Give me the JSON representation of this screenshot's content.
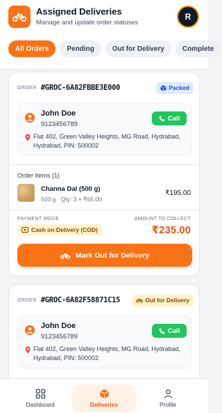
{
  "header": {
    "title": "Assigned Deliveries",
    "subtitle": "Manage and update order statuses",
    "avatar_initial": "R",
    "accent_color": "#f97316"
  },
  "tabs": [
    {
      "label": "All Orders",
      "active": true
    },
    {
      "label": "Pending",
      "active": false
    },
    {
      "label": "Out for Delivery",
      "active": false
    },
    {
      "label": "Complete",
      "active": false
    }
  ],
  "orders": [
    {
      "order_label": "ORDER",
      "order_id": "#GROC-6A82FBBE3E000",
      "status": "Packed",
      "customer": {
        "name": "John Doe",
        "phone": "9123456789",
        "call_label": "Call",
        "address": "Flat 402, Green Valley Heights, MG Road, Hydrabad, Hydrabad, PIN: 500002"
      },
      "items_label": "Order Items (1)",
      "items": [
        {
          "name": "Channa Dal (500 g)",
          "meta": "500 g · Qty: 3 × ₹65.00",
          "price": "₹195.00"
        }
      ],
      "payment_mode_label": "PAYMENT MODE",
      "payment_mode": "Cash on Delivery (COD)",
      "amount_label": "AMOUNT TO COLLECT",
      "amount": "₹235.00",
      "action_label": "Mark Out for Delivery"
    },
    {
      "order_label": "ORDER",
      "order_id": "#GROC-6A82F58871C15",
      "status": "Out for Delivery",
      "customer": {
        "name": "John Doe",
        "phone": "9123456789",
        "call_label": "Call",
        "address": "Flat 402, Green Valley Heights, MG Road, Hydrabad, Hydrabad, PIN: 500002"
      }
    }
  ],
  "bottom_nav": [
    {
      "label": "Dashboard",
      "icon": "grid-icon",
      "active": false
    },
    {
      "label": "Deliveries",
      "icon": "box-icon",
      "active": true
    },
    {
      "label": "Profile",
      "icon": "user-icon",
      "active": false
    }
  ]
}
